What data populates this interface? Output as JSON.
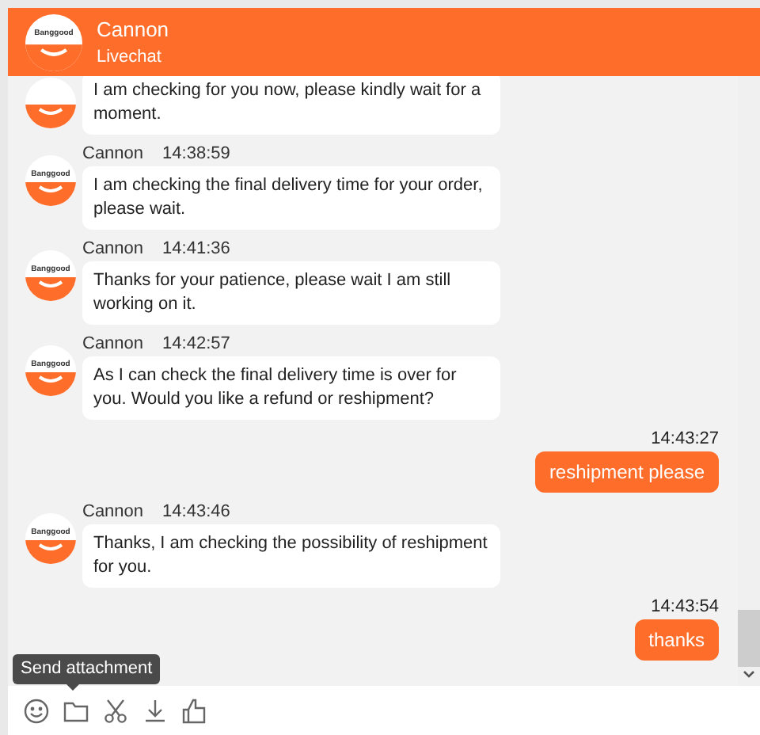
{
  "header": {
    "name": "Cannon",
    "subtitle": "Livechat",
    "avatar_label": "Banggood"
  },
  "messages": [
    {
      "kind": "agent",
      "lines": "I am checking for you now, please kindly wait for a moment."
    },
    {
      "kind": "agent",
      "avatar_label": "Banggood",
      "name": "Cannon",
      "time": "14:38:59",
      "lines": "I am checking the final delivery time for your order, please wait."
    },
    {
      "kind": "agent",
      "avatar_label": "Banggood",
      "name": "Cannon",
      "time": "14:41:36",
      "lines": "Thanks for your patience, please wait I am still working on it."
    },
    {
      "kind": "agent",
      "avatar_label": "Banggood",
      "name": "Cannon",
      "time": "14:42:57",
      "lines": "As I can check the final delivery time is over for you. Would you like a refund or reshipment?"
    },
    {
      "kind": "user",
      "time": "14:43:27",
      "lines": "reshipment please"
    },
    {
      "kind": "agent",
      "avatar_label": "Banggood",
      "name": "Cannon",
      "time": "14:43:46",
      "lines": "Thanks, I am checking the possibility of reshipment for you."
    },
    {
      "kind": "user",
      "time": "14:43:54",
      "lines": "thanks"
    }
  ],
  "tooltip": "Send attachment"
}
